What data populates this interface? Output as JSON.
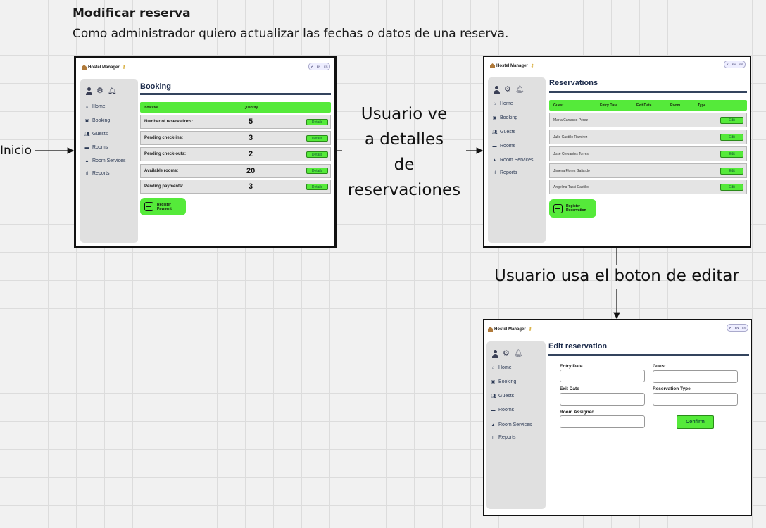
{
  "board": {
    "title": "Modificar reserva",
    "subtitle": "Como administrador quiero actualizar las fechas o datos de una reserva."
  },
  "labels": {
    "start": "Inicio",
    "step1": [
      "Usuario ve",
      "a detalles",
      "de",
      "reservaciones"
    ],
    "step2": "Usuario usa el boton de editar"
  },
  "app": {
    "logo": "Hostel Manager",
    "lang": [
      "EN",
      "ES"
    ],
    "nav": [
      "Home",
      "Booking",
      "Guests",
      "Rooms",
      "Room Services",
      "Reports"
    ]
  },
  "booking_screen": {
    "title": "Booking",
    "headers": [
      "Indicator",
      "Quantity"
    ],
    "rows": [
      {
        "label": "Number of reservations:",
        "qty": "5",
        "btn": "Details"
      },
      {
        "label": "Pending check-ins:",
        "qty": "3",
        "btn": "Details"
      },
      {
        "label": "Pending check-outs:",
        "qty": "2",
        "btn": "Details"
      },
      {
        "label": "Available rooms:",
        "qty": "20",
        "btn": "Details"
      },
      {
        "label": "Pending payments:",
        "qty": "3",
        "btn": "Details"
      }
    ],
    "action": [
      "Register",
      "Payment"
    ]
  },
  "reservations_screen": {
    "title": "Reservations",
    "headers": [
      "Guest",
      "Entry Date",
      "Exit Date",
      "Room",
      "Type"
    ],
    "rows": [
      {
        "guest": "María Carrasco Pérez",
        "btn": "Edit"
      },
      {
        "guest": "Julio Castillo Ramírez",
        "btn": "Edit"
      },
      {
        "guest": "José Cervantes Torres",
        "btn": "Edit"
      },
      {
        "guest": "Jimena Flores Galiardo",
        "btn": "Edit"
      },
      {
        "guest": "Angelina Tassi Castillo",
        "btn": "Edit"
      }
    ],
    "action": [
      "Register",
      "Reservation"
    ]
  },
  "edit_screen": {
    "title": "Edit reservation",
    "fields": [
      "Entry Date",
      "Guest",
      "Exit Date",
      "Reservation Type",
      "Room Assigned"
    ],
    "confirm": "Confirm"
  },
  "colors": {
    "accent_green": "#55ea3a",
    "navy": "#34445e",
    "sidebar": "#e0e0e0"
  }
}
